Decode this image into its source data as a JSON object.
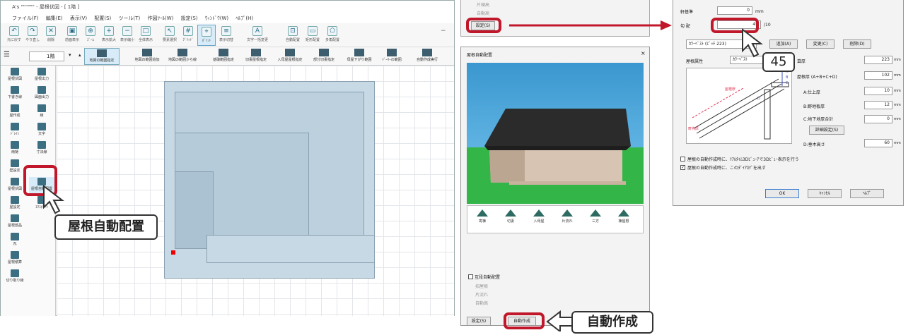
{
  "main_window": {
    "title": "A's \"\"\"\"\"\" - 屋根伏図 - [ 1階 ]",
    "menu": [
      "ファイル(F)",
      "編集(E)",
      "表示(V)",
      "配置(S)",
      "ツール(T)",
      "作図ﾂｰﾙ(W)",
      "設定(S)",
      "ｳｨﾝﾄﾞｳ(W)",
      "ﾍﾙﾌﾟ(H)"
    ],
    "toolbar": [
      "元に戻す",
      "やり直し",
      "削除",
      "前面表示",
      "ｽﾞｰﾑ",
      "表示拡大",
      "表示縮小",
      "全体表示",
      "要素選択",
      "ｸﾞﾘｯﾄﾞ",
      "ﾎﾟｲﾝﾄ",
      "表示切替",
      "文字一括変更",
      "自動配置",
      "矩形配置",
      "多角配置"
    ],
    "floor": "1階",
    "toolbar2": [
      "地図の範囲指定",
      "地図の範囲追加",
      "地図の範囲から線",
      "基礎範囲指定",
      "切妻屋根指定",
      "入母屋屋根指定",
      "部分切妻指定",
      "母屋下がり範囲",
      "ﾄﾞｰﾏｰの範囲",
      "自動作成実行"
    ],
    "left_items": [
      "屋根伏図",
      "屋根出力",
      "下書き線",
      "図面出力",
      "屋作成",
      "線",
      "ﾄﾞﾚｲﾝ",
      "文字",
      "雨樋",
      "寸法線",
      "壁設定",
      "",
      "屋根伏図",
      "屋根自動配置",
      "屋設定",
      "ｴｸｽﾎﾟｰﾄ",
      "屋根部品",
      "瓦",
      "屋根積算",
      "切り取り線"
    ]
  },
  "top_dialog": {
    "opt1": "片棟高",
    "opt2": "自動高",
    "setting_button": "設定(S)"
  },
  "mid_dialog": {
    "title": "屋根自動配置",
    "close": "×",
    "roof_types": [
      "寄棟",
      "切妻",
      "入母屋",
      "片流れ",
      "三方",
      "棟屋根"
    ],
    "checkbox_label": "互段自動配置",
    "opts": [
      "招屋根",
      "片流れ",
      "自動高"
    ],
    "setting_button": "設定(S)",
    "auto_button": "自動作成"
  },
  "right_dialog": {
    "eaves_label": "軒基準",
    "eaves_value": "0",
    "unit_mm": "mm",
    "slope_label": "勾 配",
    "slope_value": "45",
    "slope_unit": "/10",
    "color_tab": "ｶﾗｰﾍﾞｽﾄ (ﾋﾟｯﾁ 223)",
    "add_btn": "追加(A)",
    "change_btn": "変更(C)",
    "delete_btn": "削除(D)",
    "attr_label": "屋根属性",
    "attr_value": "ｶﾗｰﾍﾞｽﾄ",
    "rows": [
      {
        "label": "葺厚",
        "value": "223"
      },
      {
        "label": "屋根厚 (A+B+C+D)",
        "value": "102"
      },
      {
        "label": "A:仕上厚",
        "value": "10"
      },
      {
        "label": "B:野地板厚",
        "value": "12"
      },
      {
        "label": "C:地下地厚合計",
        "value": "0"
      },
      {
        "label": "D:垂木高さ",
        "value": "60"
      }
    ],
    "detail_btn": "詳細設定(S)",
    "diagram_labels": [
      "屋根厚",
      "軒先厚",
      "A",
      "B",
      "C",
      "D"
    ],
    "check1": "屋根の自動作成時に、ﾘｱﾙﾀｲﾑ3Dﾋﾞｭｰｱで3Dﾋﾞｭｰ表示を行う",
    "check2": "屋根の自動作成時に、このﾀﾞｲｱﾛｸﾞを出す",
    "ok": "OK",
    "cancel": "ｷｬﾝｾﾙ",
    "help": "ﾍﾙﾌﾟ"
  },
  "callouts": {
    "roof_auto": "屋根自動配置",
    "auto_create": "自動作成",
    "slope_hint": "45"
  },
  "colors": {
    "accent_red": "#c0172a",
    "sky": "#3a97cf",
    "grass": "#34b548",
    "roof": "#2b2b2b"
  }
}
